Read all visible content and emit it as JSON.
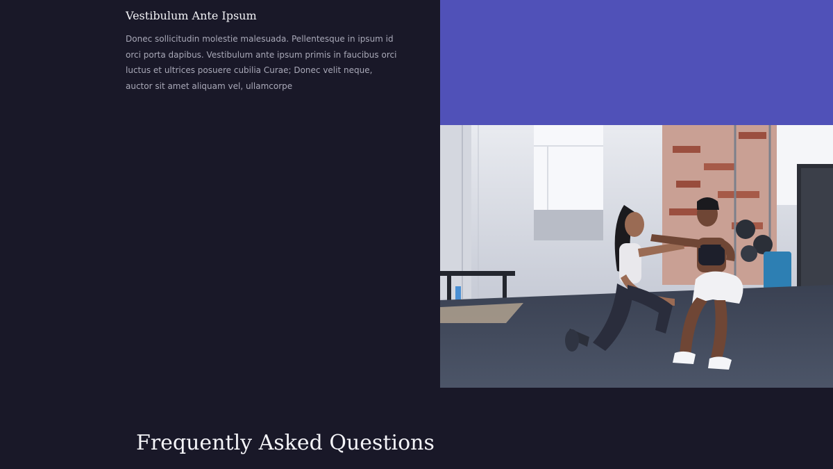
{
  "feature": {
    "title": "Vestibulum Ante Ipsum",
    "body": "Donec sollicitudin molestie malesuada. Pellentesque in ipsum id orci porta dapibus. Vestibulum ante ipsum primis in faucibus orci luctus et ultrices posuere cubilia Curae; Donec velit neque, auctor sit amet aliquam vel, ullamcorpe"
  },
  "faq": {
    "heading": "Frequently Asked Questions"
  },
  "colors": {
    "page_background": "#191828",
    "accent_block": "#5051b8",
    "heading_text": "#f2f2f6",
    "body_text": "#a9a9b8"
  }
}
